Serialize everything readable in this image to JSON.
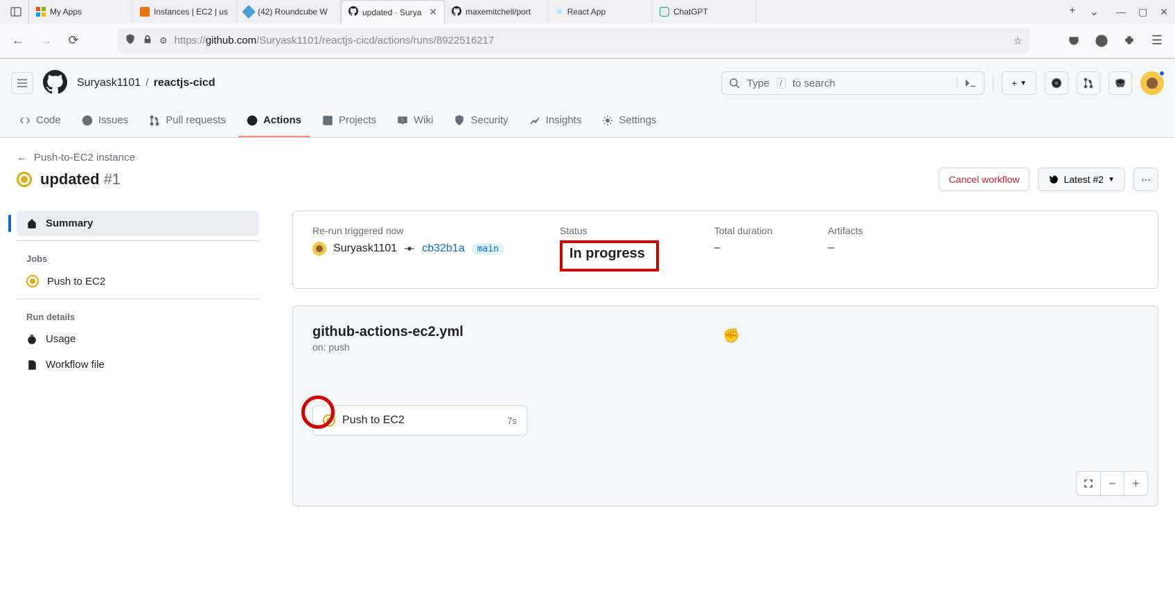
{
  "browser": {
    "tabs": [
      {
        "title": "My Apps"
      },
      {
        "title": "Instances | EC2 | us"
      },
      {
        "title": "(42) Roundcube W"
      },
      {
        "title": "updated · Surya"
      },
      {
        "title": "maxemitchell/port"
      },
      {
        "title": "React App"
      },
      {
        "title": "ChatGPT"
      }
    ],
    "url_proto": "https://",
    "url_host": "github.com",
    "url_path": "/Suryask1101/reactjs-cicd/actions/runs/8922516217"
  },
  "repo": {
    "owner": "Suryask1101",
    "name": "reactjs-cicd",
    "search_placeholder": "Type",
    "search_suffix": "to search",
    "slash": "/"
  },
  "nav": {
    "code": "Code",
    "issues": "Issues",
    "pulls": "Pull requests",
    "actions": "Actions",
    "projects": "Projects",
    "wiki": "Wiki",
    "security": "Security",
    "insights": "Insights",
    "settings": "Settings"
  },
  "run": {
    "back_label": "Push-to-EC2 instance",
    "title": "updated",
    "number": "#1",
    "cancel": "Cancel workflow",
    "latest": "Latest #2"
  },
  "sidebar": {
    "summary": "Summary",
    "jobs_heading": "Jobs",
    "job1": "Push to EC2",
    "details_heading": "Run details",
    "usage": "Usage",
    "workflow_file": "Workflow file"
  },
  "summary": {
    "trigger_label": "Re-run triggered now",
    "actor": "Suryask1101",
    "commit": "cb32b1a",
    "branch": "main",
    "status_label": "Status",
    "status_value": "In progress",
    "duration_label": "Total duration",
    "duration_value": "–",
    "artifacts_label": "Artifacts",
    "artifacts_value": "–"
  },
  "workflow": {
    "filename": "github-actions-ec2.yml",
    "trigger": "on: push",
    "job_name": "Push to EC2",
    "job_time": "7s"
  }
}
